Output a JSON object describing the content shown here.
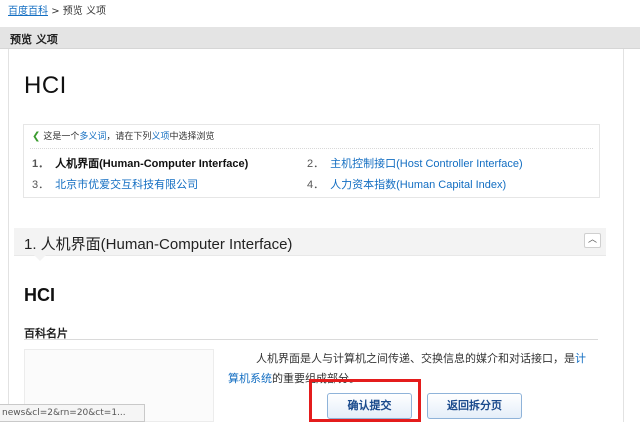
{
  "breadcrumb": {
    "home": "百度百科",
    "separator": ">",
    "current": "预览 义项"
  },
  "titlebar": {
    "title": "预览 义项"
  },
  "page": {
    "title": "HCI"
  },
  "disambiguation": {
    "note_prefix": "这是一个",
    "note_link": "多义词",
    "note_middle": "，请在下列",
    "note_link2": "义项",
    "note_suffix": "中选择浏览",
    "entries": [
      {
        "num": "1．",
        "label": "人机界面(Human-Computer Interface)",
        "current": true
      },
      {
        "num": "2．",
        "label": "主机控制接口(Host Controller Interface)",
        "current": false
      },
      {
        "num": "3．",
        "label": "北京市优爱交互科技有限公司",
        "current": false
      },
      {
        "num": "4．",
        "label": "人力资本指数(Human Capital Index)",
        "current": false
      }
    ]
  },
  "section": {
    "title": "1. 人机界面(Human-Computer Interface)",
    "collapse_icon": "chevron-up-icon",
    "collapse_glyph": "︿"
  },
  "subtitle": "HCI",
  "card": {
    "heading": "百科名片"
  },
  "intro": {
    "text1": "人机界面是人与计算机之间传递、交换信息的媒介和对话接口，是",
    "link": "计算机系统",
    "text2": "的重要组成部分。"
  },
  "statusbar": {
    "text": "news&cl=2&rn=20&ct=1..."
  },
  "buttons": {
    "confirm": "确认提交",
    "back": "返回拆分页"
  },
  "colors": {
    "link": "#136ec2",
    "highlight": "#e41c1c",
    "button_text": "#1a4a8c"
  }
}
